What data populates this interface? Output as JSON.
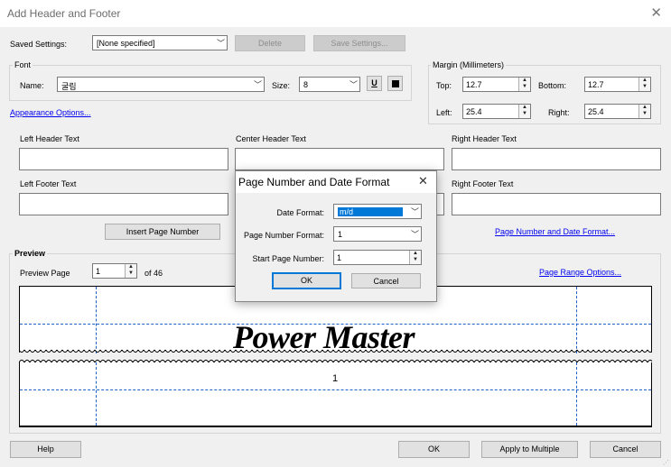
{
  "window": {
    "title": "Add Header and Footer",
    "close_glyph": "✕"
  },
  "saved_settings": {
    "label": "Saved Settings:",
    "value": "[None specified]",
    "delete_label": "Delete",
    "save_label": "Save Settings..."
  },
  "font": {
    "group_label": "Font",
    "name_label": "Name:",
    "name_value": "굴림",
    "size_label": "Size:",
    "size_value": "8",
    "underline_glyph": "U"
  },
  "margin": {
    "group_label": "Margin (Millimeters)",
    "top_label": "Top:",
    "top_value": "12.7",
    "bottom_label": "Bottom:",
    "bottom_value": "12.7",
    "left_label": "Left:",
    "left_value": "25.4",
    "right_label": "Right:",
    "right_value": "25.4"
  },
  "appearance_link": "Appearance Options...",
  "header_fields": {
    "left": "Left Header Text",
    "center": "Center Header Text",
    "right": "Right Header Text"
  },
  "footer_fields": {
    "left": "Left Footer Text",
    "right": "Right Footer Text"
  },
  "insert_page_number": "Insert Page Number",
  "page_number_format_link": "Page Number and Date Format...",
  "preview": {
    "group_label": "Preview",
    "page_label": "Preview Page",
    "page_value": "1",
    "of_label": "of 46",
    "range_link": "Page Range Options...",
    "header_text": "Power Master",
    "footer_text": "1"
  },
  "dialog": {
    "title": "Page Number and Date Format",
    "close_glyph": "✕",
    "date_format_label": "Date Format:",
    "date_format_value": "m/d",
    "page_number_format_label": "Page Number Format:",
    "page_number_format_value": "1",
    "start_page_label": "Start Page Number:",
    "start_page_value": "1",
    "ok": "OK",
    "cancel": "Cancel"
  },
  "footer_buttons": {
    "help": "Help",
    "ok": "OK",
    "apply": "Apply to Multiple",
    "cancel": "Cancel"
  },
  "colors": {
    "accent": "#0078d7",
    "link": "#0000ee",
    "guide": "#1f5fc8"
  }
}
